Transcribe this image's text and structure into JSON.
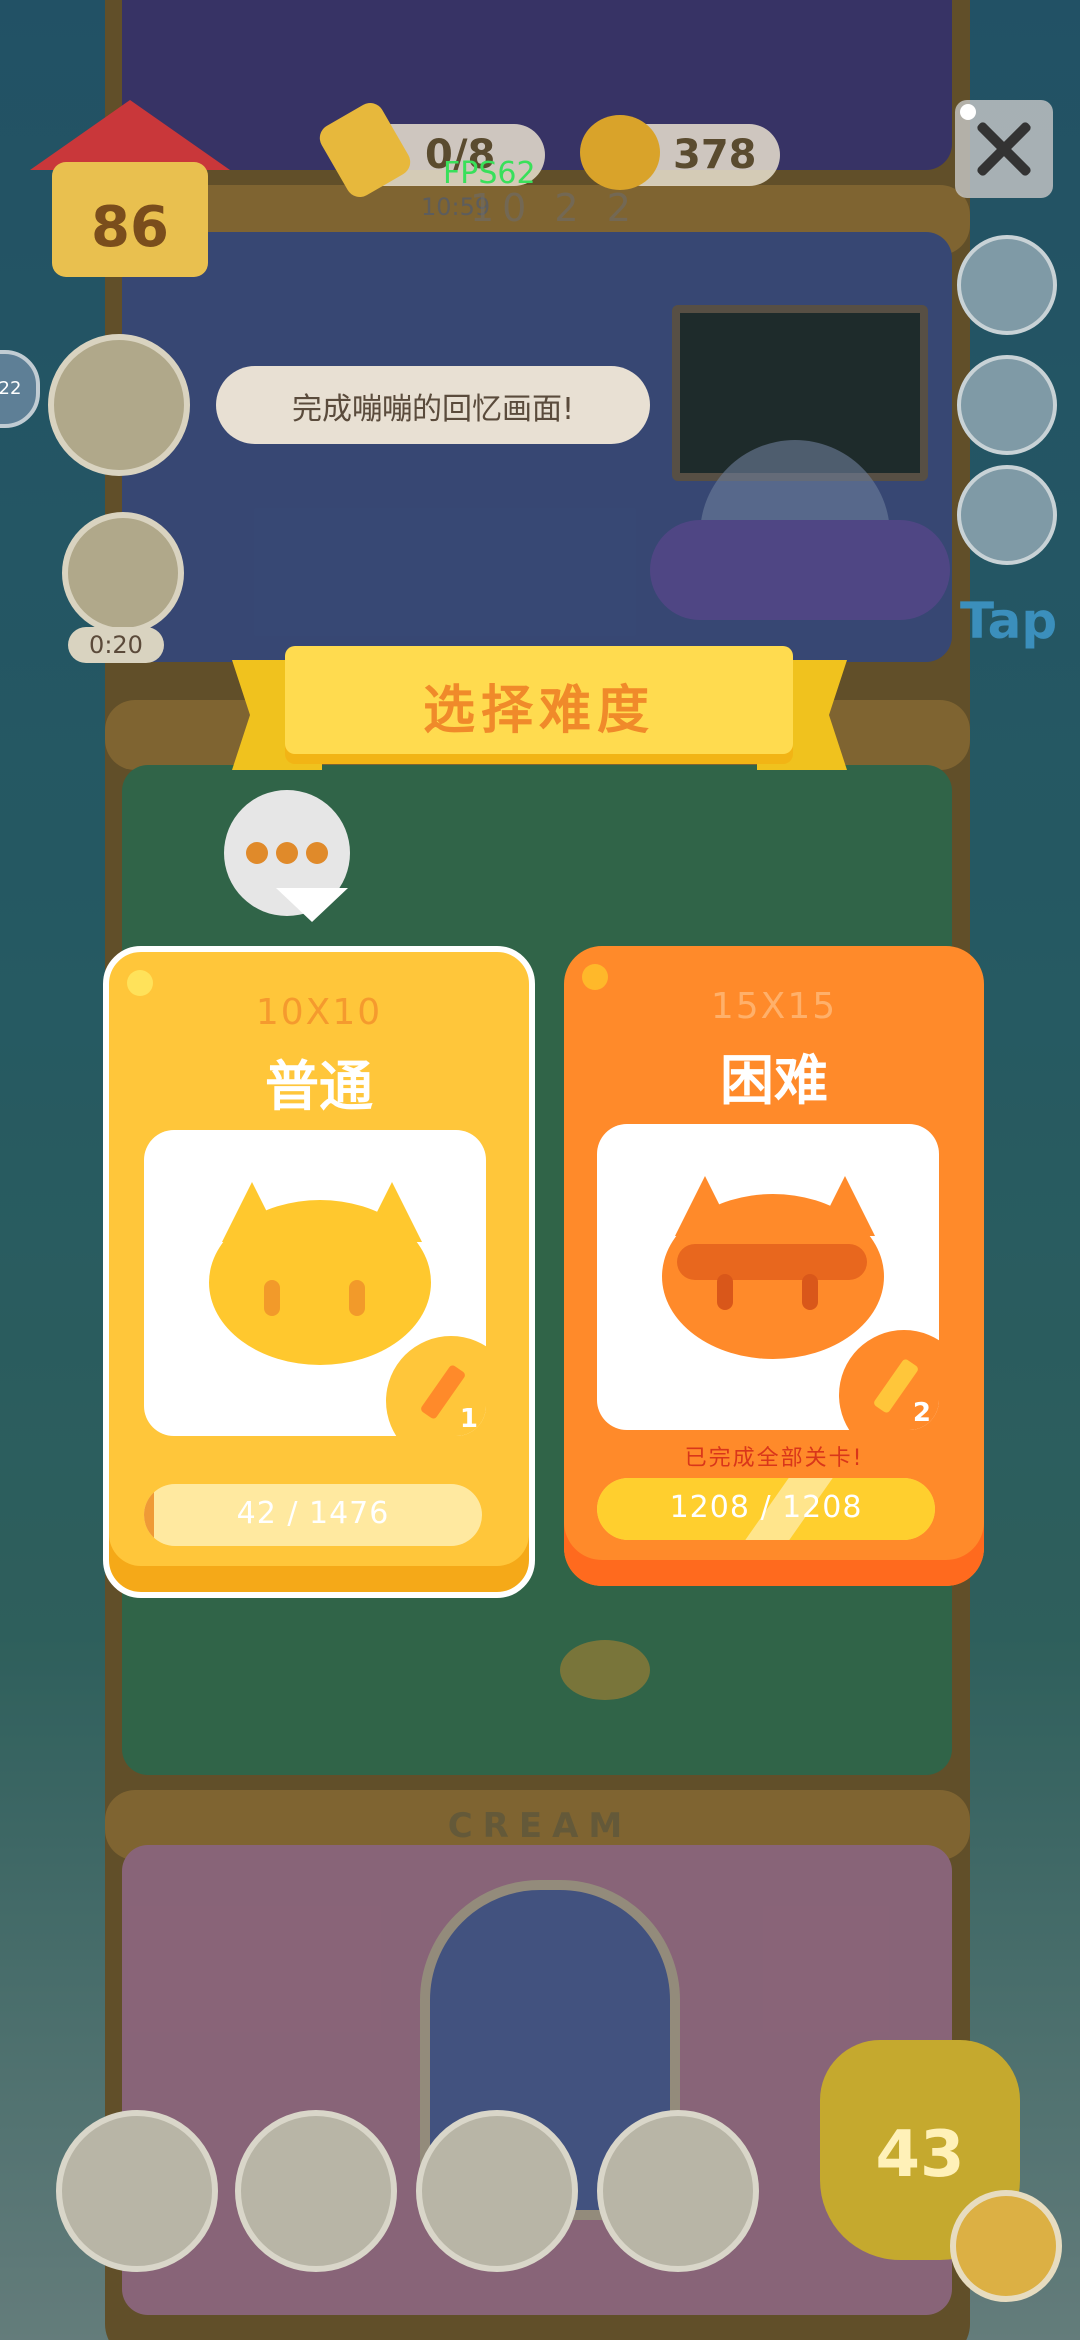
{
  "hud": {
    "house_level": "86",
    "pencils": "0/8",
    "coins": "378",
    "fps": "FPS62",
    "clock": "10:59",
    "clock_big": "10 2 2",
    "side_badge": "22",
    "tap_label": "Tap",
    "gift_timer": "0:20",
    "quest_text": "完成嘣嘣的回忆画面!",
    "bottom_counter": "43"
  },
  "scene": {
    "floor_label": "CREAM"
  },
  "modal": {
    "title": "选择难度",
    "options": [
      {
        "size": "10X10",
        "name": "普通",
        "pencil_cost": "1",
        "completed_note": "",
        "progress_text": "42 / 1476",
        "progress": 0.0285,
        "selected": true
      },
      {
        "size": "15X15",
        "name": "困难",
        "pencil_cost": "2",
        "completed_note": "已完成全部关卡!",
        "progress_text": "1208 / 1208",
        "progress": 1.0,
        "selected": false
      }
    ]
  },
  "colors": {
    "normal_card": "#ffc63a",
    "hard_card": "#ff8a2a",
    "title_ribbon": "#ffdb4f",
    "title_text": "#f08a2a",
    "fps_text": "#39e05a"
  },
  "icons": {
    "house": "house-icon",
    "pencil": "pencil-icon",
    "coin": "coin-can-icon",
    "close": "close-icon",
    "settings": "gear-icon",
    "gift": "gift-icon",
    "more": "more-dots-icon"
  }
}
